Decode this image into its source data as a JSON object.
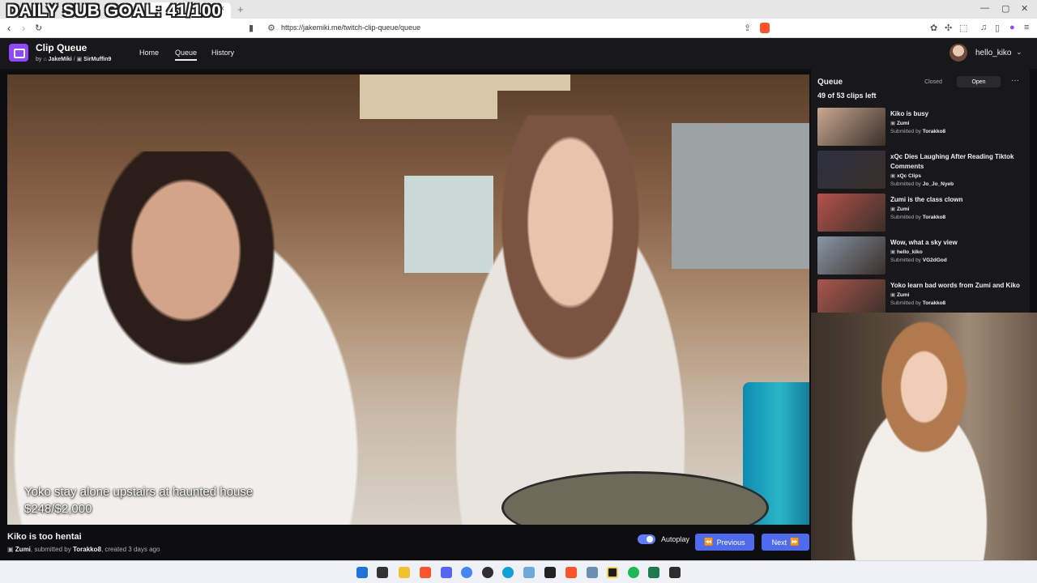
{
  "overlay": {
    "goal": "DAILY SUB GOAL: 41/100"
  },
  "browser": {
    "url": "https://jakemiki.me/twitch-clip-queue/queue",
    "tab_close": "×",
    "new_tab": "+"
  },
  "app": {
    "title": "Clip Queue",
    "by": "by",
    "author1": "JakeMiki",
    "sep": "/",
    "author2": "SirMuffin9",
    "nav": {
      "home": "Home",
      "queue": "Queue",
      "history": "History"
    },
    "user": "hello_kiko"
  },
  "video": {
    "caption_line1": "Yoko stay alone upstairs at haunted house",
    "caption_line2": "$248/$2,000"
  },
  "current_clip": {
    "title": "Kiko is too hentai",
    "channel": "Zumi",
    "submitted_prefix": ", submitted by",
    "submitter": "Torakko8",
    "created": ", created 3 days ago"
  },
  "controls": {
    "autoplay_label": "Autoplay",
    "autoplay_on": true,
    "previous_label": "Previous",
    "next_label": "Next"
  },
  "queue": {
    "title": "Queue",
    "closed_label": "Closed",
    "open_label": "Open",
    "more": "···",
    "count": "49 of 53 clips left",
    "submitted_by": "Submitted by",
    "items": [
      {
        "title": "Kiko is busy",
        "channel": "Zumi",
        "submitter": "Torakko8",
        "thumb_color": "#c8a890"
      },
      {
        "title": "xQc Dies Laughing After Reading Tiktok Comments",
        "channel": "xQc Clips",
        "submitter": "Jo_Jo_Nyeb",
        "thumb_color": "#2d3142"
      },
      {
        "title": "Zumi is the class clown",
        "channel": "Zumi",
        "submitter": "Torakko8",
        "thumb_color": "#b5524a"
      },
      {
        "title": "Wow, what a sky view",
        "channel": "hello_kiko",
        "submitter": "VG2dGod",
        "thumb_color": "#8896a6"
      },
      {
        "title": "Yoko learn bad words from Zumi and Kiko",
        "channel": "Zumi",
        "submitter": "Torakko8",
        "thumb_color": "#a8564c"
      }
    ]
  }
}
